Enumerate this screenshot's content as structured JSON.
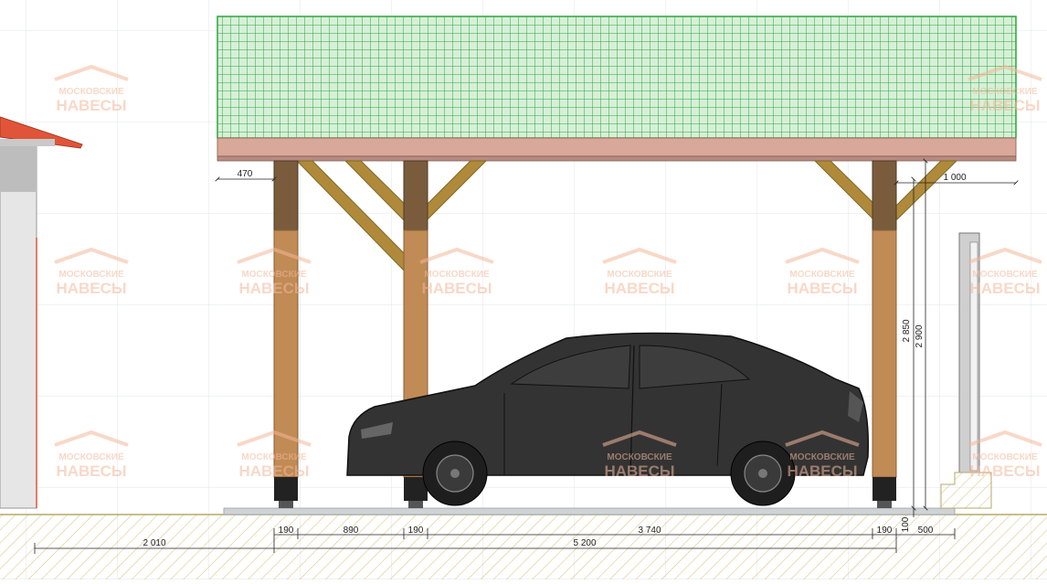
{
  "watermark": {
    "line1": "МОСКОВСКИЕ",
    "line2": "НАВЕСЫ"
  },
  "dimensions": {
    "overhang_left": "470",
    "overhang_right": "1 000",
    "height_beam": "2 850",
    "height_total": "2 900",
    "post_1": "190",
    "gap_1": "890",
    "post_2": "190",
    "span_main": "3 740",
    "post_3": "190",
    "base_height": "100",
    "offset_right": "500",
    "house_offset": "2 010",
    "total_length": "5 200"
  },
  "colors": {
    "roof_grid": "#2ea43a",
    "roof_fill": "#cdeccf",
    "beam": "#d9a89a",
    "post": "#c08b55",
    "post_dark": "#7a5c3d",
    "brace": "#b08a3a",
    "car": "#333333",
    "hatch": "#d8c98a",
    "house_roof": "#e0553a",
    "dim_text": "#222222"
  }
}
